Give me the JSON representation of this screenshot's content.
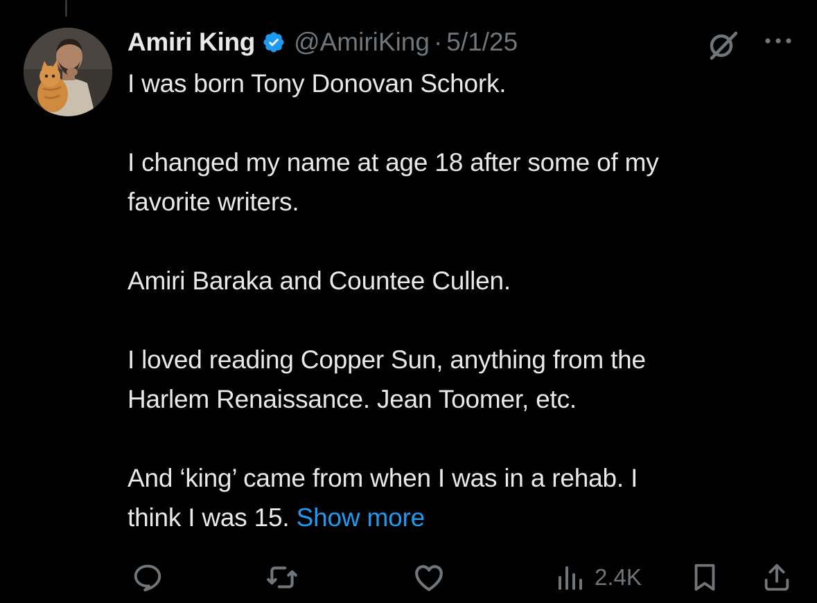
{
  "tweet": {
    "display_name": "Amiri King",
    "handle": "@AmiriKing",
    "separator": "·",
    "timestamp": "5/1/25",
    "verified_icon": "verified-badge-icon",
    "paragraphs": [
      [
        "I was born Tony Donovan Schork."
      ],
      [
        "I changed my name at age 18 after some of my",
        "favorite writers."
      ],
      [
        "Amiri Baraka and Countee Cullen."
      ],
      [
        "I loved reading Copper Sun, anything from the",
        "Harlem Renaissance. Jean Toomer, etc."
      ],
      [
        "And ‘king’ came from when I was in a rehab. I",
        "think I was 15."
      ]
    ],
    "show_more_label": "Show more"
  },
  "actions": {
    "reply_icon": "reply-icon",
    "retweet_icon": "retweet-icon",
    "like_icon": "heart-icon",
    "views_icon": "analytics-icon",
    "views_count": "2.4K",
    "bookmark_icon": "bookmark-icon",
    "share_icon": "share-icon"
  },
  "header_icons": {
    "grok": "grok-icon",
    "more": "more-options-icon"
  },
  "colors": {
    "background": "#000000",
    "primary_text": "#e7e9ea",
    "secondary_text": "#71767b",
    "link": "#1d9bf0",
    "verified": "#1d9bf0"
  }
}
